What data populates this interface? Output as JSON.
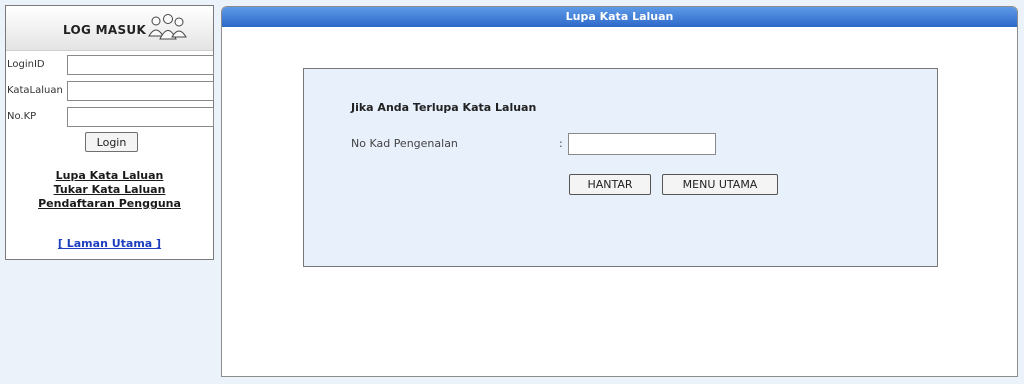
{
  "login": {
    "title": "LOG MASUK",
    "fields": [
      {
        "label": "LoginID",
        "value": ""
      },
      {
        "label": "KataLaluan",
        "value": ""
      },
      {
        "label": "No.KP",
        "value": ""
      }
    ],
    "login_button": "Login",
    "links": [
      "Lupa Kata Laluan",
      "Tukar Kata Laluan",
      "Pendaftaran Pengguna"
    ],
    "home_link": "[ Laman Utama ]"
  },
  "main": {
    "header": "Lupa Kata Laluan",
    "form": {
      "heading": "Jika Anda Terlupa Kata Laluan",
      "field_label": "No Kad Pengenalan",
      "colon": ":",
      "field_value": "",
      "submit_button": "HANTAR",
      "menu_button": "MENU UTAMA"
    }
  },
  "colors": {
    "page_background": "#ecf2fa",
    "header_blue": "#2d68c8",
    "form_background": "#e7f0fb",
    "home_link": "#1d3fbf"
  }
}
